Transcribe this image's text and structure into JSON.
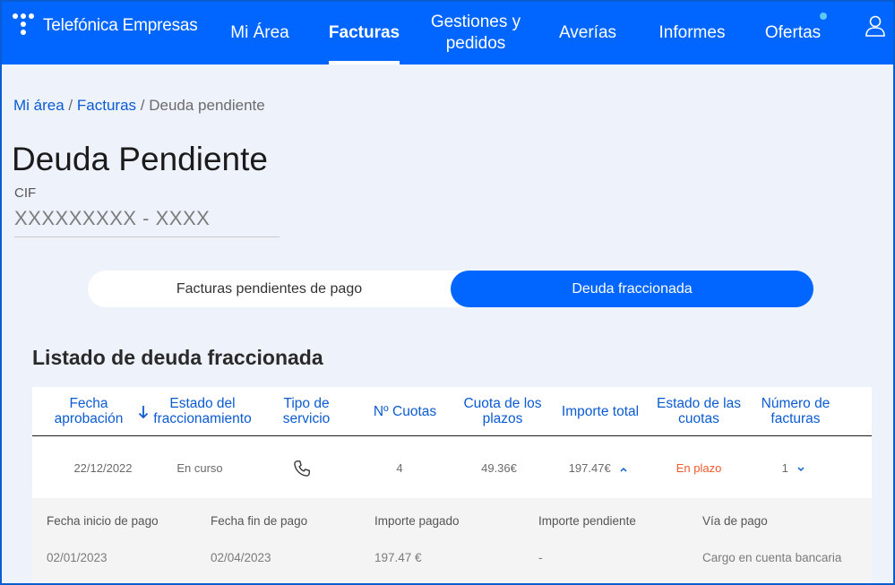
{
  "nav": {
    "brand": "Telefónica Empresas",
    "items": [
      {
        "label": "Mi Área"
      },
      {
        "label": "Facturas"
      },
      {
        "label": "Gestiones y pedidos"
      },
      {
        "label": "Averías"
      },
      {
        "label": "Informes"
      },
      {
        "label": "Ofertas"
      }
    ],
    "active": "Facturas"
  },
  "breadcrumb": {
    "items": [
      "Mi área",
      "Facturas",
      "Deuda pendiente"
    ],
    "separator": "/"
  },
  "page": {
    "title": "Deuda Pendiente",
    "cif_label": "CIF",
    "cif_value": "XXXXXXXXX - XXXX"
  },
  "toggle": {
    "options": [
      "Facturas pendientes de pago",
      "Deuda fraccionada"
    ],
    "selected": "Deuda fraccionada"
  },
  "list": {
    "title": "Listado de deuda fraccionada",
    "headers": [
      "Fecha aprobación",
      "Estado del fraccionamiento",
      "Tipo de servicio",
      "Nº Cuotas",
      "Cuota de los plazos",
      "Importe total",
      "Estado de las cuotas",
      "Número de facturas"
    ],
    "row": {
      "fecha": "22/12/2022",
      "estado": "En curso",
      "tipo_icon": "phone-icon",
      "cuotas": "4",
      "cuota_plazos": "49.36€",
      "importe_total": "197.47€",
      "estado_cuotas": "En plazo",
      "num_facturas": "1"
    },
    "detail": {
      "labels": [
        "Fecha inicio de pago",
        "Fecha fin de pago",
        "Importe pagado",
        "Importe pendiente",
        "Vía de pago"
      ],
      "values": [
        "02/01/2023",
        "02/04/2023",
        "197.47 €",
        "-",
        "Cargo en cuenta bancaria"
      ]
    }
  },
  "colors": {
    "primary": "#0066ff",
    "link": "#0b5bd1",
    "status_orange": "#ef5a2c",
    "notification_dot": "#5ec7f5"
  }
}
